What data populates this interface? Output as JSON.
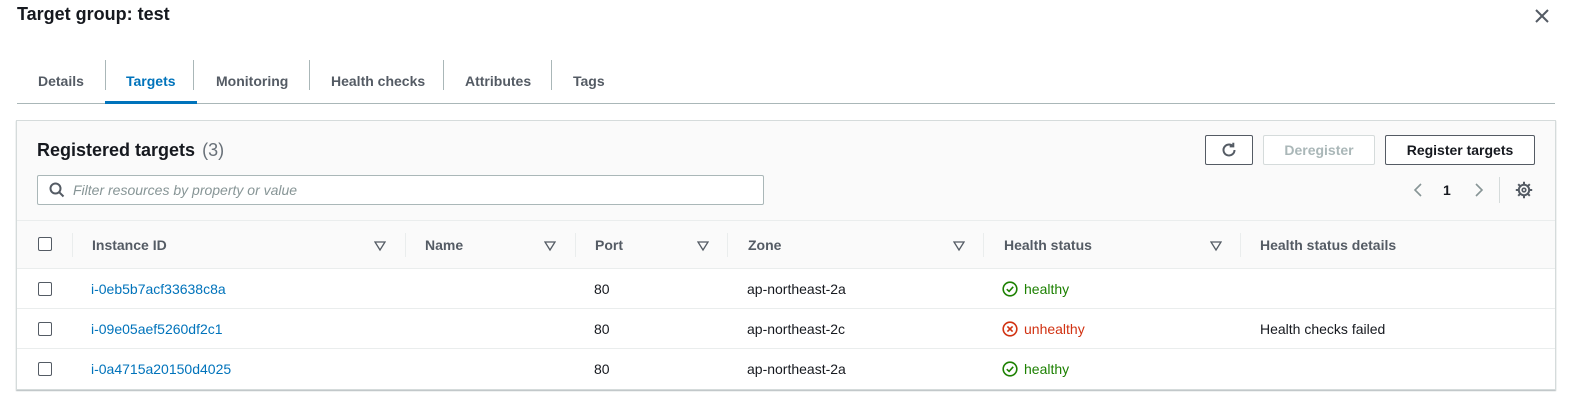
{
  "header": {
    "title": "Target group: test"
  },
  "tabs": [
    {
      "label": "Details"
    },
    {
      "label": "Targets"
    },
    {
      "label": "Monitoring"
    },
    {
      "label": "Health checks"
    },
    {
      "label": "Attributes"
    },
    {
      "label": "Tags"
    }
  ],
  "active_tab": "Targets",
  "panel": {
    "title": "Registered targets",
    "count": "(3)",
    "deregister_label": "Deregister",
    "register_label": "Register targets",
    "search_placeholder": "Filter resources by property or value",
    "page": "1"
  },
  "columns": [
    {
      "label": "Instance ID"
    },
    {
      "label": "Name"
    },
    {
      "label": "Port"
    },
    {
      "label": "Zone"
    },
    {
      "label": "Health status"
    },
    {
      "label": "Health status details"
    }
  ],
  "rows": [
    {
      "instance_id": "i-0eb5b7acf33638c8a",
      "name": "",
      "port": "80",
      "zone": "ap-northeast-2a",
      "health": "healthy",
      "details": ""
    },
    {
      "instance_id": "i-09e05aef5260df2c1",
      "name": "",
      "port": "80",
      "zone": "ap-northeast-2c",
      "health": "unhealthy",
      "details": "Health checks failed"
    },
    {
      "instance_id": "i-0a4715a20150d4025",
      "name": "",
      "port": "80",
      "zone": "ap-northeast-2a",
      "health": "healthy",
      "details": ""
    }
  ],
  "colors": {
    "accent": "#0073bb",
    "healthy": "#1d8102",
    "unhealthy": "#d13212"
  }
}
